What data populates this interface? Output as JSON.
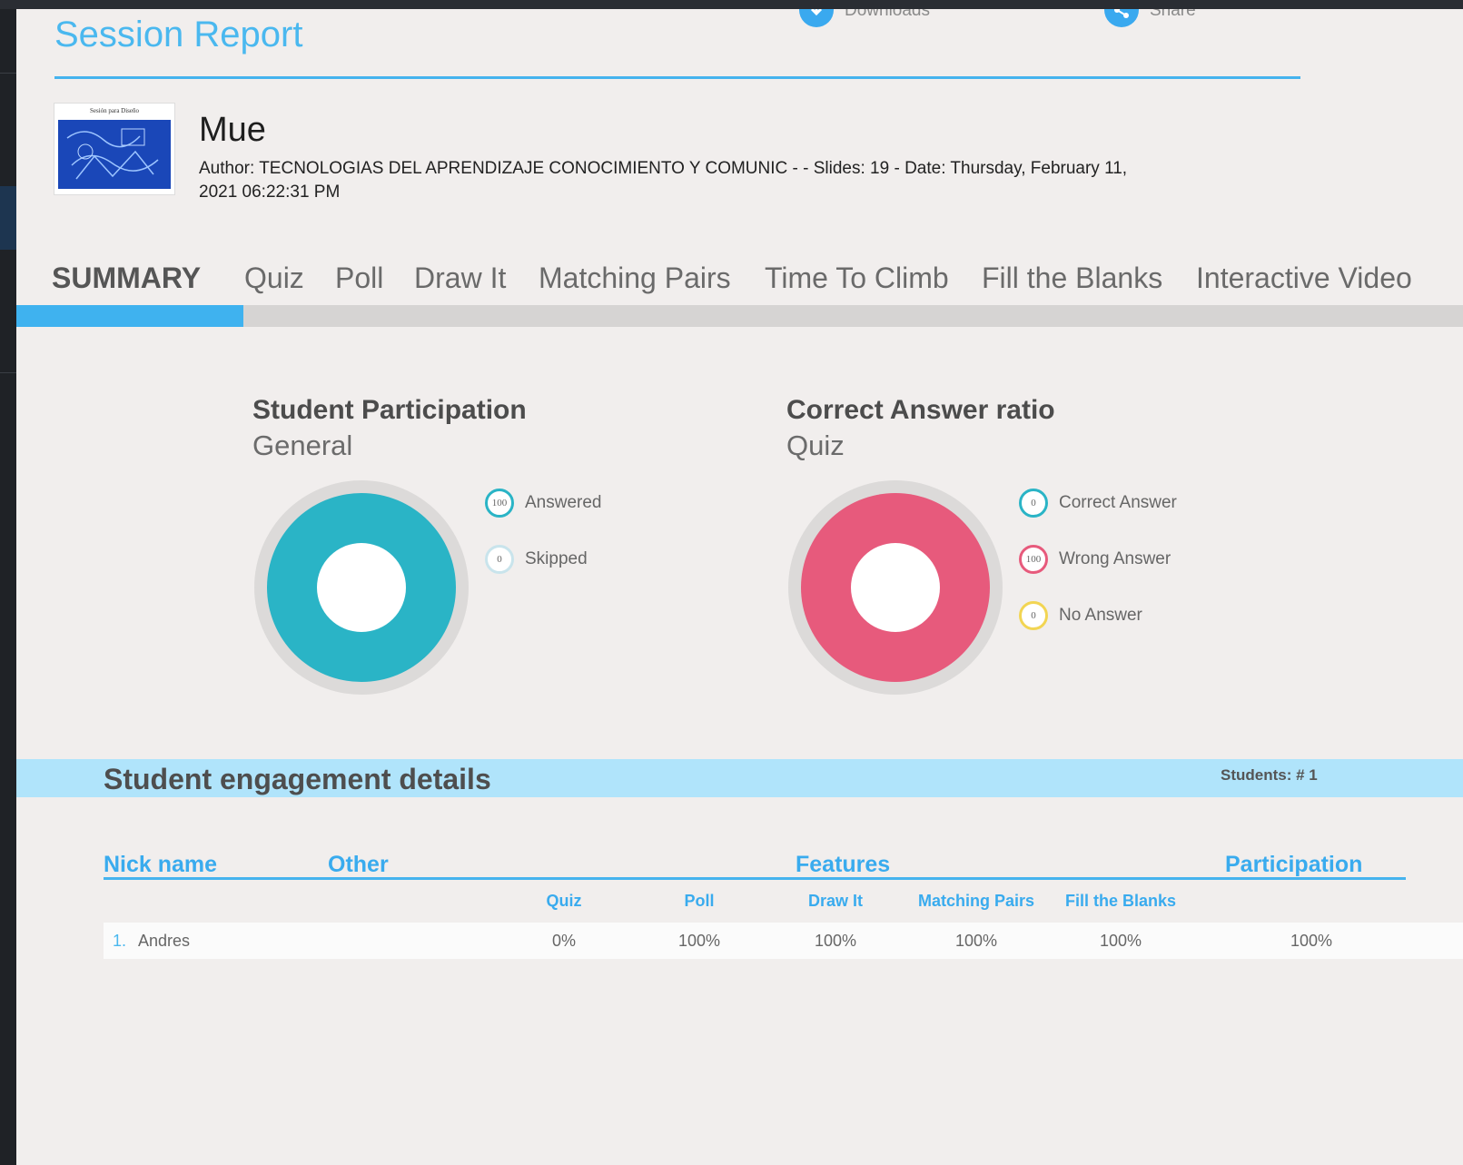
{
  "app": {
    "title": "Session Report"
  },
  "actions": [
    {
      "label": "Downloads",
      "icon": "download-icon"
    },
    {
      "label": "Share",
      "icon": "share-icon"
    }
  ],
  "presentation": {
    "thumbnail_caption": "Sesión para Diseño",
    "title": "Mue",
    "meta_line1": "Author: TECNOLOGIAS DEL APRENDIZAJE CONOCIMIENTO Y COMUNIC - - Slides: 19 - Date: Thursday, February 11,",
    "meta_line2": "2021 06:22:31 PM"
  },
  "tabs": [
    "SUMMARY",
    "Quiz",
    "Poll",
    "Draw It",
    "Matching Pairs",
    "Time To Climb",
    "Fill the Blanks",
    "Interactive Video"
  ],
  "active_tab": "SUMMARY",
  "charts": {
    "participation": {
      "title": "Student Participation",
      "subtitle": "General",
      "legend": [
        {
          "label": "Answered",
          "value": "100",
          "color": "#2ab4c6"
        },
        {
          "label": "Skipped",
          "value": "0",
          "color": "#c9e4ec"
        }
      ]
    },
    "correct_ratio": {
      "title": "Correct Answer ratio",
      "subtitle": "Quiz",
      "legend": [
        {
          "label": "Correct Answer",
          "value": "0",
          "color": "#2ab4c6"
        },
        {
          "label": "Wrong Answer",
          "value": "100",
          "color": "#e75a7c"
        },
        {
          "label": "No Answer",
          "value": "0",
          "color": "#f2d553"
        }
      ]
    }
  },
  "chart_data": [
    {
      "type": "pie",
      "title": "Student Participation",
      "subtitle": "General",
      "categories": [
        "Answered",
        "Skipped"
      ],
      "values": [
        100,
        0
      ],
      "colors": [
        "#2ab4c6",
        "#c9e4ec"
      ]
    },
    {
      "type": "pie",
      "title": "Correct Answer ratio",
      "subtitle": "Quiz",
      "categories": [
        "Correct Answer",
        "Wrong Answer",
        "No Answer"
      ],
      "values": [
        0,
        100,
        0
      ],
      "colors": [
        "#2ab4c6",
        "#e75a7c",
        "#f2d553"
      ]
    }
  ],
  "engagement": {
    "title": "Student engagement details",
    "students_count": "Students: # 1",
    "headers": {
      "nickname": "Nick name",
      "other": "Other",
      "features": "Features",
      "participation": "Participation"
    },
    "feature_columns": [
      "Quiz",
      "Poll",
      "Draw It",
      "Matching Pairs",
      "Fill the Blanks"
    ],
    "rows": [
      {
        "num": "1.",
        "name": "Andres",
        "values": [
          "0%",
          "100%",
          "100%",
          "100%",
          "100%"
        ],
        "participation": "100%"
      }
    ]
  },
  "colors": {
    "accent": "#45b3ee",
    "band": "#b0e4fb",
    "teal": "#2ab4c6",
    "pink": "#e75a7c",
    "yellow": "#f2d553"
  }
}
